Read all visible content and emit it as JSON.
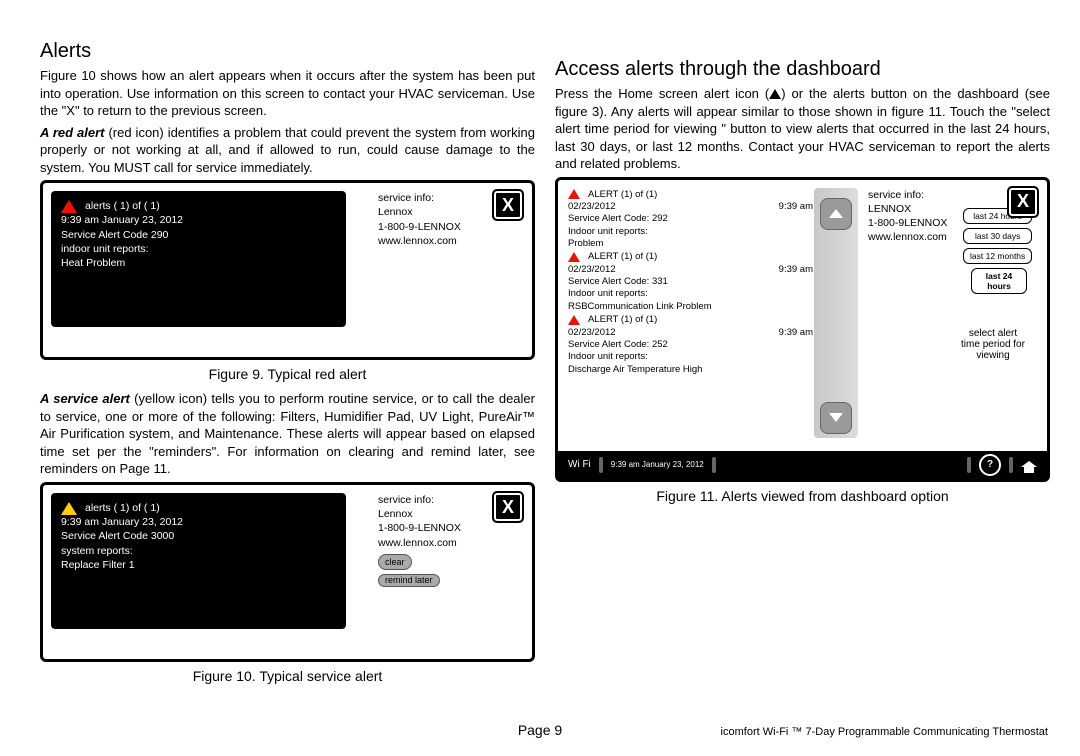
{
  "left": {
    "heading": "Alerts",
    "intro": "Figure 10 shows how an alert appears when it occurs after the system has been put into operation. Use information on this screen to contact your HVAC serviceman. Use the \"X\" to return to the previous screen.",
    "redLead": "A red alert",
    "redRest": " (red icon) identifies a problem that could prevent the system from working properly or not working at all, and if allowed to run, could cause damage to the system. You MUST call for service immediately.",
    "fig9": {
      "caption": "Figure 9. Typical red alert",
      "counter": "alerts ( 1) of ( 1)",
      "time": "9:39 am January 23, 2012",
      "code": "Service Alert Code 290",
      "unit": "indoor unit reports:",
      "msg": "Heat Problem",
      "svcLabel": "service info:",
      "svc1": "Lennox",
      "svc2": "1-800-9-LENNOX",
      "svc3": "www.lennox.com",
      "x": "X"
    },
    "svcLead": "A service alert",
    "svcRest": " (yellow icon) tells you to perform routine service, or to call the dealer to service, one or more of the following: Filters, Humidifier Pad, UV Light, PureAir™ Air Purification system, and Maintenance. These alerts will appear based on elapsed time set per the \"reminders\". For information on clearing and remind later, see reminders on Page 11.",
    "fig10": {
      "caption": "Figure 10. Typical service alert",
      "counter": "alerts ( 1) of ( 1)",
      "time": "9:39 am January 23, 2012",
      "code": "Service Alert Code 3000",
      "unit": "system reports:",
      "msg": "Replace Filter 1",
      "svcLabel": "service info:",
      "svc1": "Lennox",
      "svc2": "1-800-9-LENNOX",
      "svc3": "www.lennox.com",
      "clear": "clear",
      "remind": "remind later",
      "x": "X"
    }
  },
  "right": {
    "heading": "Access alerts through the dashboard",
    "introA": "Press the Home screen alert icon (",
    "introB": ") or the alerts   button on the dashboard (see figure 3). Any alerts will appear similar to those shown in figure 11. Touch the \"select alert time period for viewing     \" button to view alerts that occurred in the last 24 hours, last 30 days, or last 12 months. Contact your HVAC serviceman to report the alerts and related problems.",
    "fig11": {
      "caption": "Figure 11. Alerts   viewed from dashboard option",
      "x": "X",
      "svcLabel": "service info:",
      "svc1": "LENNOX",
      "svc2": "1-800-9LENNOX",
      "svc3": "www.lennox.com",
      "alerts": [
        {
          "hdr": "ALERT (1) of (1)",
          "date": "02/23/2012",
          "time": "9:39 am",
          "code": "Service Alert Code: 292",
          "unit": "Indoor unit reports:",
          "msg": "Problem"
        },
        {
          "hdr": "ALERT (1) of (1)",
          "date": "02/23/2012",
          "time": "9:39 am",
          "code": "Service Alert Code: 331",
          "unit": "Indoor unit reports:",
          "msg": "RSBCommunication Link Problem"
        },
        {
          "hdr": "ALERT (1) of (1)",
          "date": "02/23/2012",
          "time": "9:39 am",
          "code": "Service Alert Code: 252",
          "unit": "Indoor unit reports:",
          "msg": "Discharge Air Temperature High"
        }
      ],
      "periods": [
        "last 24 hours",
        "last 30 days",
        "last 12 months"
      ],
      "selected": "last 24 hours",
      "selectText1": "select alert",
      "selectText2": "time period for",
      "selectText3": "viewing",
      "status": {
        "wifi": "Wi Fi",
        "dt": "9:39 am January 23, 2012",
        "q": "?"
      }
    }
  },
  "footer": {
    "page": "Page 9",
    "prod": "icomfort Wi-Fi ™ 7-Day Programmable Communicating Thermostat"
  }
}
